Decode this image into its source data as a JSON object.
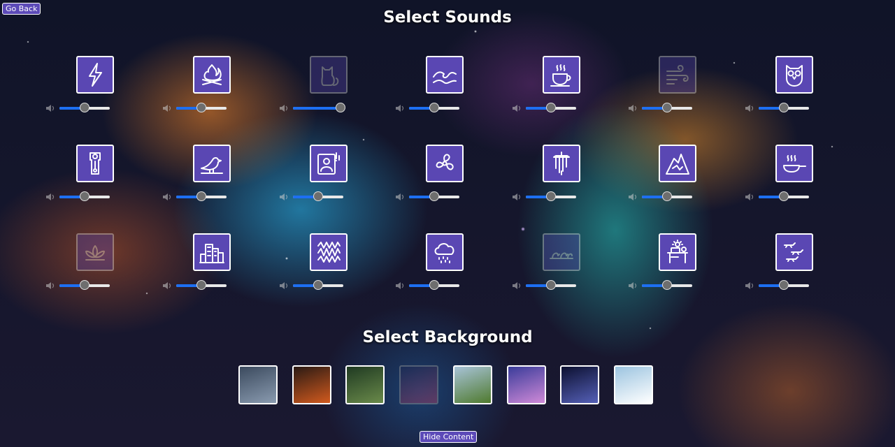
{
  "buttons": {
    "go_back": "Go Back",
    "hide_content": "Hide Content"
  },
  "titles": {
    "sounds": "Select Sounds",
    "background": "Select Background"
  },
  "sounds": [
    {
      "icon": "lightning-icon",
      "volume": 0.5,
      "active": true
    },
    {
      "icon": "campfire-icon",
      "volume": 0.5,
      "active": true
    },
    {
      "icon": "cat-icon",
      "volume": 0.95,
      "active": false
    },
    {
      "icon": "waves-icon",
      "volume": 0.5,
      "active": true
    },
    {
      "icon": "coffee-cup-icon",
      "volume": 0.5,
      "active": true
    },
    {
      "icon": "wind-icon",
      "volume": 0.5,
      "active": false
    },
    {
      "icon": "owl-icon",
      "volume": 0.5,
      "active": true
    },
    {
      "icon": "grandfather-clock-icon",
      "volume": 0.5,
      "active": true
    },
    {
      "icon": "seagull-icon",
      "volume": 0.5,
      "active": true
    },
    {
      "icon": "singing-person-icon",
      "volume": 0.5,
      "active": true
    },
    {
      "icon": "fan-icon",
      "volume": 0.5,
      "active": true
    },
    {
      "icon": "wind-chimes-icon",
      "volume": 0.5,
      "active": true
    },
    {
      "icon": "landslide-icon",
      "volume": 0.5,
      "active": true
    },
    {
      "icon": "frying-pan-icon",
      "volume": 0.5,
      "active": true
    },
    {
      "icon": "lotus-icon",
      "volume": 0.5,
      "active": false
    },
    {
      "icon": "city-icon",
      "volume": 0.5,
      "active": true
    },
    {
      "icon": "white-noise-icon",
      "volume": 0.5,
      "active": true
    },
    {
      "icon": "rain-cloud-icon",
      "volume": 0.5,
      "active": true
    },
    {
      "icon": "birds-on-wire-icon",
      "volume": 0.5,
      "active": false
    },
    {
      "icon": "office-desk-icon",
      "volume": 0.5,
      "active": true
    },
    {
      "icon": "airplanes-icon",
      "volume": 0.5,
      "active": true
    }
  ],
  "backgrounds": [
    {
      "name": "storm-thumbnail",
      "colors": [
        "#3b4a5e",
        "#8a9bb0"
      ],
      "active": true
    },
    {
      "name": "lava-thumbnail",
      "colors": [
        "#2a1a14",
        "#d25a1e"
      ],
      "active": true
    },
    {
      "name": "forest-thumbnail",
      "colors": [
        "#1f3a22",
        "#6a8a4a"
      ],
      "active": true
    },
    {
      "name": "nebula-thumbnail",
      "colors": [
        "#1b2a55",
        "#b0406a"
      ],
      "active": false
    },
    {
      "name": "meadow-thumbnail",
      "colors": [
        "#a8c3d8",
        "#4f7a2e"
      ],
      "active": true
    },
    {
      "name": "coral-reef-thumbnail",
      "colors": [
        "#3a3c9a",
        "#d08ad8"
      ],
      "active": true
    },
    {
      "name": "night-sky-thumbnail",
      "colors": [
        "#0c1030",
        "#5560b8"
      ],
      "active": true
    },
    {
      "name": "mountains-thumbnail",
      "colors": [
        "#9cc4e0",
        "#ffffff"
      ],
      "active": true
    }
  ]
}
